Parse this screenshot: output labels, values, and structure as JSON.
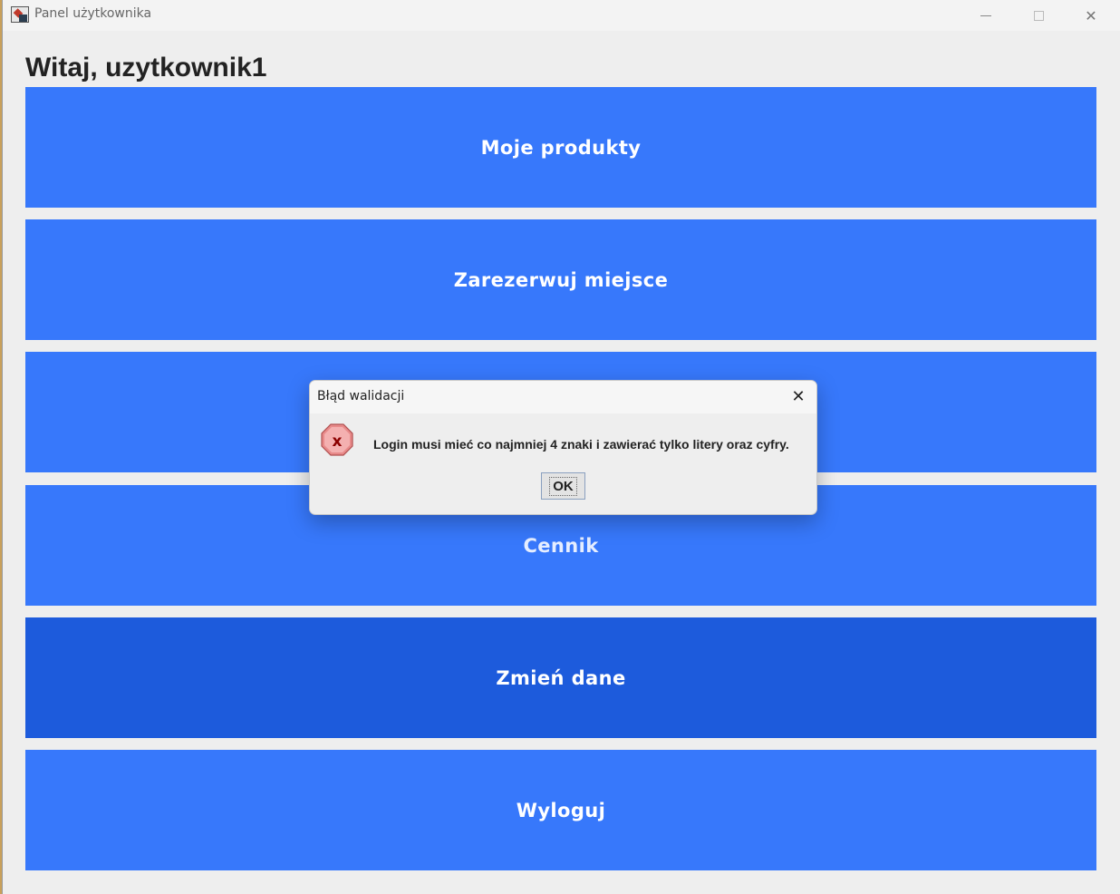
{
  "window": {
    "title": "Panel użytkownika",
    "controls": {
      "minimize": "minimize-icon",
      "maximize": "maximize-icon",
      "close": "✕"
    }
  },
  "main": {
    "greeting": "Witaj, uzytkownik1",
    "buttons": [
      {
        "label": "Moje produkty"
      },
      {
        "label": "Zarezerwuj miejsce"
      },
      {
        "label": ""
      },
      {
        "label": "Cennik"
      },
      {
        "label": "Zmień dane"
      },
      {
        "label": "Wyloguj"
      }
    ],
    "colors": {
      "button": "#3778fb",
      "button_hover": "#1d5bdc"
    }
  },
  "dialog": {
    "title": "Błąd walidacji",
    "close": "✕",
    "icon": "error-icon",
    "message": "Login musi mieć co najmniej 4 znaki i zawierać tylko litery oraz cyfry.",
    "ok_label": "OK"
  }
}
